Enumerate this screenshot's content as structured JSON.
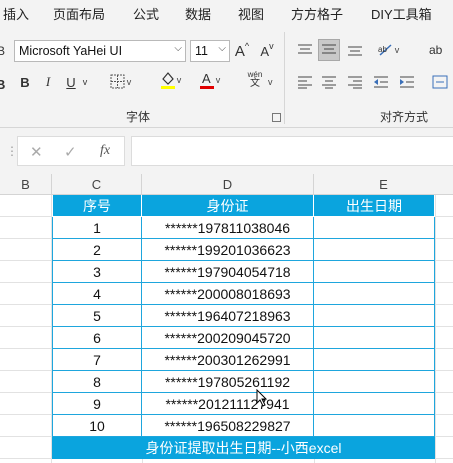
{
  "tabs": [
    "插入",
    "页面布局",
    "公式",
    "数据",
    "视图",
    "方方格子",
    "DIY工具箱"
  ],
  "ribbon": {
    "font_name": "Microsoft YaHei UI",
    "font_size": "11",
    "bold": "B",
    "italic": "I",
    "underline": "U",
    "grow_font": "A",
    "shrink_font": "A",
    "wen_top": "wén",
    "wen_bottom": "文",
    "wrap_label": "ab",
    "font_group": "字体",
    "align_group": "对齐方式",
    "left_edge": "B",
    "left_edge_top": "B"
  },
  "formula_bar": {
    "fx": "fx",
    "value": ""
  },
  "columns": [
    "B",
    "C",
    "D",
    "E"
  ],
  "table": {
    "headers": [
      "序号",
      "身份证",
      "出生日期"
    ],
    "rows": [
      [
        "1",
        "******197811038046",
        ""
      ],
      [
        "2",
        "******199201036623",
        ""
      ],
      [
        "3",
        "******197904054718",
        ""
      ],
      [
        "4",
        "******200008018693",
        ""
      ],
      [
        "5",
        "******196407218963",
        ""
      ],
      [
        "6",
        "******200209045720",
        ""
      ],
      [
        "7",
        "******200301262991",
        ""
      ],
      [
        "8",
        "******197805261192",
        ""
      ],
      [
        "9",
        "******201211127941",
        ""
      ],
      [
        "10",
        "******196508229827",
        ""
      ]
    ],
    "footer": "身份证提取出生日期--小西excel"
  },
  "colors": {
    "accent": "#0aa4de",
    "highlight": "#ffff00",
    "font_color": "#e00000"
  }
}
